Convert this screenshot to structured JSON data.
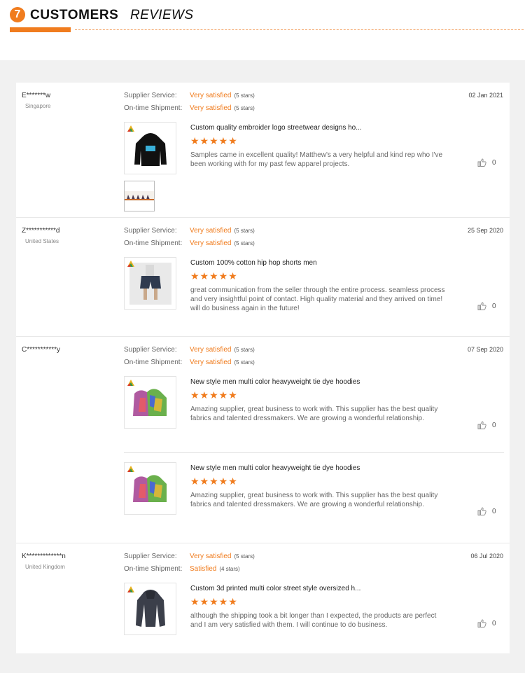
{
  "header": {
    "badge": "7",
    "title_bold": "CUSTOMERS",
    "title_italic": "REVIEWS",
    "accent": "#f07c1e"
  },
  "labels": {
    "supplier_service": "Supplier Service:",
    "ontime_shipment": "On-time Shipment:"
  },
  "reviews": [
    {
      "reviewer": "E*******w",
      "country": "Singapore",
      "date": "02 Jan 2021",
      "supplier_value": "Very satisfied",
      "supplier_stars": "(5 stars)",
      "shipment_value": "Very satisfied",
      "shipment_stars": "(5 stars)",
      "items": [
        {
          "product": "Custom quality embroider logo streetwear designs ho...",
          "stars": "★★★★★",
          "text": "Samples came in excellent quality! Matthew's a very helpful and kind rep who I've been working with for my past few apparel projects.",
          "likes": "0"
        }
      ]
    },
    {
      "reviewer": "Z***********d",
      "country": "United States",
      "date": "25 Sep 2020",
      "supplier_value": "Very satisfied",
      "supplier_stars": "(5 stars)",
      "shipment_value": "Very satisfied",
      "shipment_stars": "(5 stars)",
      "items": [
        {
          "product": "Custom 100% cotton hip hop shorts men",
          "stars": "★★★★★",
          "text": "great communication from the seller through the entire process. seamless process and very insightful point of contact. High quality material and they arrived on time! will do business again in the future!",
          "likes": "0"
        }
      ]
    },
    {
      "reviewer": "C***********y",
      "country": "",
      "date": "07 Sep 2020",
      "supplier_value": "Very satisfied",
      "supplier_stars": "(5 stars)",
      "shipment_value": "Very satisfied",
      "shipment_stars": "(5 stars)",
      "items": [
        {
          "product": "New style men multi color heavyweight tie dye hoodies",
          "stars": "★★★★★",
          "text": "Amazing supplier, great business to work with. This supplier has the best quality fabrics and talented dressmakers. We are growing a wonderful relationship.",
          "likes": "0"
        },
        {
          "product": "New style men multi color heavyweight tie dye hoodies",
          "stars": "★★★★★",
          "text": "Amazing supplier, great business to work with. This supplier has the best quality fabrics and talented dressmakers. We are growing a wonderful relationship.",
          "likes": "0"
        }
      ]
    },
    {
      "reviewer": "K*************n",
      "country": "United Kingdom",
      "date": "06 Jul 2020",
      "supplier_value": "Very satisfied",
      "supplier_stars": "(5 stars)",
      "shipment_value": "Satisfied",
      "shipment_stars": "(4 stars)",
      "items": [
        {
          "product": "Custom 3d printed multi color street style oversized h...",
          "stars": "★★★★★",
          "text": "although the shipping took a bit longer than I expected, the products are perfect and I am very satisfied with them. I will continue to do business.",
          "likes": "0"
        }
      ]
    }
  ]
}
